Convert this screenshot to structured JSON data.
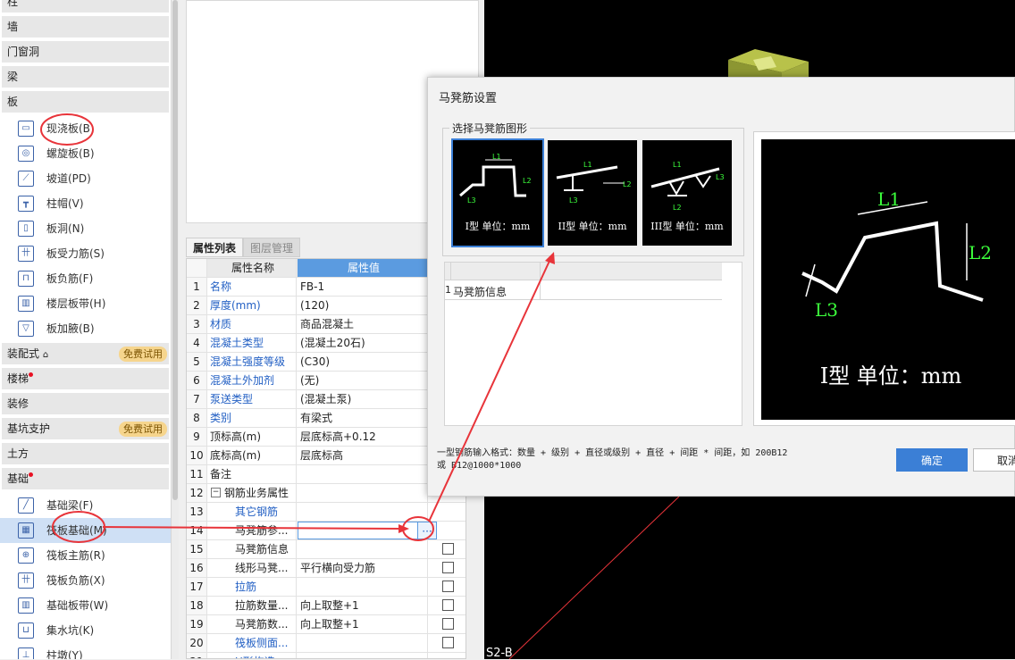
{
  "left_panel": {
    "cat_column": "柱",
    "cat_wall": "墙",
    "cat_door": "门窗洞",
    "cat_beam": "梁",
    "cat_slab": "板",
    "slab_items": [
      "现浇板(B)",
      "螺旋板(B)",
      "坡道(PD)",
      "柱帽(V)",
      "板洞(N)",
      "板受力筋(S)",
      "板负筋(F)",
      "楼层板带(H)",
      "板加腋(B)"
    ],
    "cat_prefab": "装配式",
    "trial_label": "免费试用",
    "cat_stairs": "楼梯",
    "cat_decor": "装修",
    "cat_pit": "基坑支护",
    "cat_earth": "土方",
    "cat_foundation": "基础",
    "foundation_items": [
      "基础梁(F)",
      "筏板基础(M)",
      "筏板主筋(R)",
      "筏板负筋(X)",
      "基础板带(W)",
      "集水坑(K)",
      "柱墩(Y)"
    ]
  },
  "property_panel": {
    "tab_props": "属性列表",
    "tab_layers": "图层管理",
    "col_name": "属性名称",
    "col_value": "属性值",
    "rows": [
      {
        "n": "1",
        "name": "名称",
        "value": "FB-1",
        "blue": true,
        "chk": false
      },
      {
        "n": "2",
        "name": "厚度(mm)",
        "value": "(120)",
        "blue": true,
        "chk": false
      },
      {
        "n": "3",
        "name": "材质",
        "value": "商品混凝土",
        "blue": true,
        "chk": false
      },
      {
        "n": "4",
        "name": "混凝土类型",
        "value": "(混凝土20石)",
        "blue": true,
        "chk": false
      },
      {
        "n": "5",
        "name": "混凝土强度等级",
        "value": "(C30)",
        "blue": true,
        "chk": false
      },
      {
        "n": "6",
        "name": "混凝土外加剂",
        "value": "(无)",
        "blue": true,
        "chk": false
      },
      {
        "n": "7",
        "name": "泵送类型",
        "value": "(混凝土泵)",
        "blue": true,
        "chk": false
      },
      {
        "n": "8",
        "name": "类别",
        "value": "有梁式",
        "blue": true,
        "chk": false
      },
      {
        "n": "9",
        "name": "顶标高(m)",
        "value": "层底标高+0.12",
        "blue": false,
        "chk": false
      },
      {
        "n": "10",
        "name": "底标高(m)",
        "value": "层底标高",
        "blue": false,
        "chk": false
      },
      {
        "n": "11",
        "name": "备注",
        "value": "",
        "blue": false,
        "chk": false
      },
      {
        "n": "12",
        "name": "钢筋业务属性",
        "value": "",
        "blue": false,
        "chk": false
      },
      {
        "n": "13",
        "name": "其它钢筋",
        "value": "",
        "blue": true,
        "chk": false
      },
      {
        "n": "14",
        "name": "马凳筋参...",
        "value": "",
        "blue": false,
        "chk": false
      },
      {
        "n": "15",
        "name": "马凳筋信息",
        "value": "",
        "blue": false,
        "chk": true
      },
      {
        "n": "16",
        "name": "线形马凳...",
        "value": "平行横向受力筋",
        "blue": false,
        "chk": true
      },
      {
        "n": "17",
        "name": "拉筋",
        "value": "",
        "blue": true,
        "chk": true
      },
      {
        "n": "18",
        "name": "拉筋数量...",
        "value": "向上取整+1",
        "blue": false,
        "chk": true
      },
      {
        "n": "19",
        "name": "马凳筋数...",
        "value": "向上取整+1",
        "blue": false,
        "chk": true
      },
      {
        "n": "20",
        "name": "筏板侧面...",
        "value": "",
        "blue": true,
        "chk": true
      },
      {
        "n": "21",
        "name": "U形构造...",
        "value": "",
        "blue": true,
        "chk": false
      }
    ],
    "ellipsis": "···"
  },
  "canvas": {
    "label": "S2-B"
  },
  "dialog": {
    "title": "马凳筋设置",
    "group_label": "选择马凳筋图形",
    "shapes": [
      {
        "label": "I型 单位：mm"
      },
      {
        "label": "II型 单位：mm"
      },
      {
        "label": "III型 单位：mm"
      }
    ],
    "shape_dims": {
      "l1": "L1",
      "l2": "L2",
      "l3": "L3"
    },
    "table_row_num": "1",
    "table_row_label": "马凳筋信息",
    "preview_label": "I型 单位：mm",
    "hint_line1": "一型钢筋输入格式：数量 + 级别 + 直径或级别 + 直径 + 间距 * 间距，如 200B12",
    "hint_line2": "或 B12@1000*1000",
    "ok": "确定",
    "cancel": "取消"
  }
}
